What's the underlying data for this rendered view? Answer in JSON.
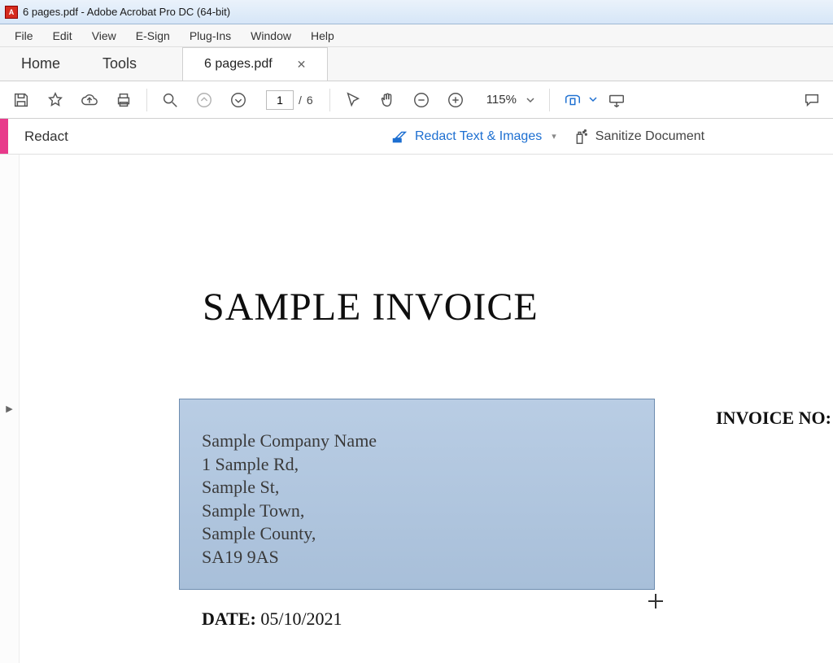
{
  "window": {
    "title": "6 pages.pdf - Adobe Acrobat Pro DC (64-bit)"
  },
  "menu": {
    "items": [
      "File",
      "Edit",
      "View",
      "E-Sign",
      "Plug-Ins",
      "Window",
      "Help"
    ]
  },
  "tabs": {
    "home": "Home",
    "tools": "Tools",
    "file": "6 pages.pdf"
  },
  "toolbar": {
    "page_current": "1",
    "page_total": "6",
    "page_sep": "/",
    "zoom": "115%"
  },
  "redact": {
    "label": "Redact",
    "redact_text": "Redact Text & Images",
    "sanitize": "Sanitize Document"
  },
  "document": {
    "title": "SAMPLE INVOICE",
    "address": [
      "Sample Company Name",
      "1 Sample Rd,",
      "Sample St,",
      "Sample Town,",
      "Sample County,",
      "SA19 9AS"
    ],
    "invoice_no_label": "INVOICE NO:",
    "date_label": "DATE:",
    "date_value": "05/10/2021"
  }
}
